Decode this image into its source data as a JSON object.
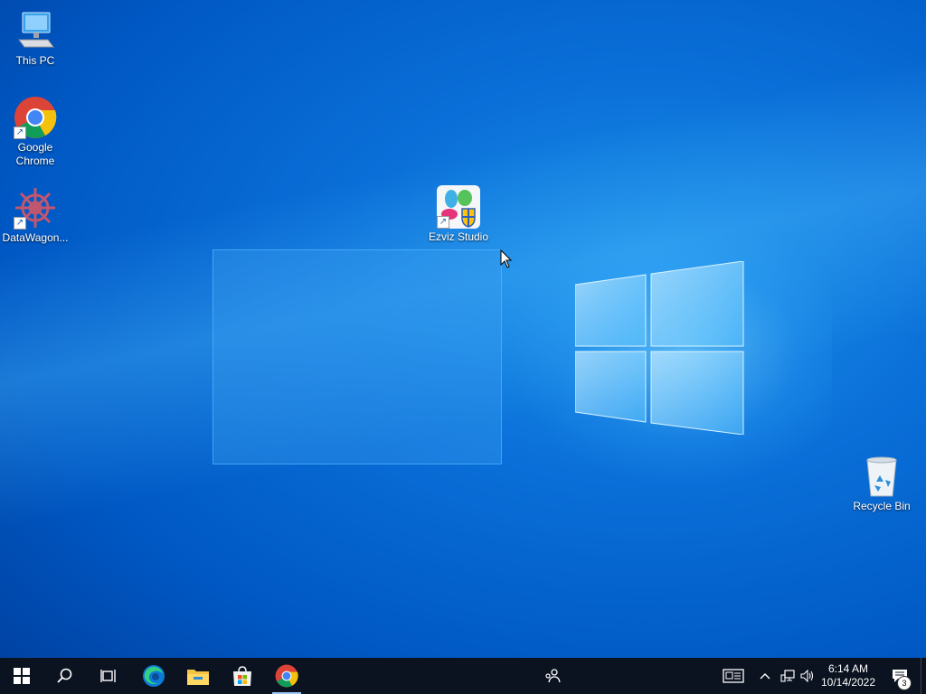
{
  "desktop": {
    "icons": [
      {
        "label": "This PC",
        "icon": "this-pc-icon"
      },
      {
        "label": "Google Chrome",
        "icon": "chrome-icon"
      },
      {
        "label": "DataWagon...",
        "icon": "datawagon-icon"
      },
      {
        "label": "Ezviz Studio",
        "icon": "ezviz-studio-icon"
      },
      {
        "label": "Recycle Bin",
        "icon": "recycle-bin-icon"
      }
    ]
  },
  "taskbar": {
    "pinned": [
      "start",
      "search",
      "task-view",
      "edge",
      "file-explorer",
      "microsoft-store",
      "chrome"
    ],
    "clock": {
      "time": "6:14 AM",
      "date": "10/14/2022"
    },
    "notification_count": "3"
  },
  "colors": {
    "taskbar_bg": "#0b1220",
    "desktop_accent": "#0a6fd8"
  }
}
